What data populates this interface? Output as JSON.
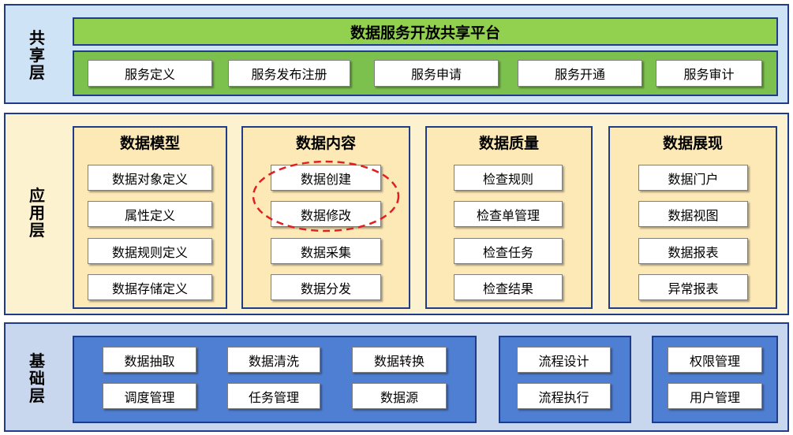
{
  "colors": {
    "shared_bg": "#cfe3f7",
    "app_bg": "#fdf2d0",
    "base_bg": "#c9d7ee",
    "green": "#92d050",
    "yellow_panel": "#fde9b6",
    "blue_panel": "#4f7fd3",
    "border": "#1f3c88",
    "highlight": "#e02020"
  },
  "shared_layer": {
    "label_chars": [
      "共",
      "享",
      "层"
    ],
    "title": "数据服务开放共享平台",
    "services": [
      "服务定义",
      "服务发布注册",
      "服务申请",
      "服务开通",
      "服务审计"
    ]
  },
  "app_layer": {
    "label_chars": [
      "应",
      "用",
      "层"
    ],
    "panels": [
      {
        "title": "数据模型",
        "items": [
          "数据对象定义",
          "属性定义",
          "数据规则定义",
          "数据存储定义"
        ]
      },
      {
        "title": "数据内容",
        "items": [
          "数据创建",
          "数据修改",
          "数据采集",
          "数据分发"
        ]
      },
      {
        "title": "数据质量",
        "items": [
          "检查规则",
          "检查单管理",
          "检查任务",
          "检查结果"
        ]
      },
      {
        "title": "数据展现",
        "items": [
          "数据门户",
          "数据视图",
          "数据报表",
          "异常报表"
        ]
      }
    ]
  },
  "base_layer": {
    "label_chars": [
      "基",
      "础",
      "层"
    ],
    "group1": [
      "数据抽取",
      "数据清洗",
      "数据转换",
      "调度管理",
      "任务管理",
      "数据源"
    ],
    "group2": [
      "流程设计",
      "流程执行"
    ],
    "group3": [
      "权限管理",
      "用户管理"
    ]
  }
}
